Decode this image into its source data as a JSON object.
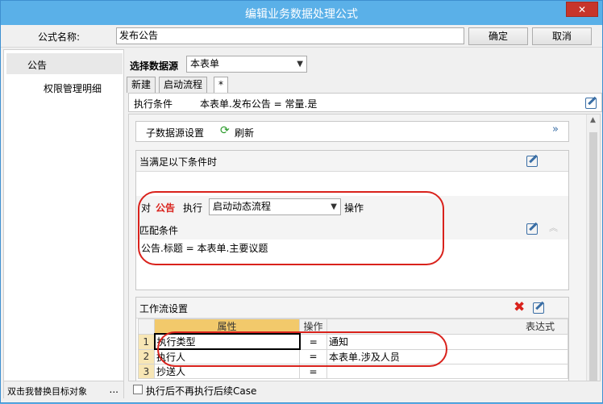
{
  "window": {
    "title": "编辑业务数据处理公式",
    "close_label": "✕"
  },
  "top": {
    "name_label": "公式名称:",
    "name_value": "发布公告",
    "ok_label": "确定",
    "cancel_label": "取消"
  },
  "sidebar": {
    "items": [
      {
        "label": "公告"
      },
      {
        "label": "权限管理明细"
      }
    ],
    "replace_target_label": "双击我替换目标对象",
    "more_label": "..."
  },
  "datasource": {
    "label": "选择数据源",
    "value": "本表单"
  },
  "tabs": [
    {
      "label": "新建"
    },
    {
      "label": "启动流程"
    },
    {
      "label": "*"
    }
  ],
  "exec_condition": {
    "label": "执行条件",
    "value": "本表单.发布公告 = 常量.是"
  },
  "subsource": {
    "label": "子数据源设置",
    "refresh_label": "刷新"
  },
  "when_panel": {
    "header": "当满足以下条件时"
  },
  "action_row": {
    "prefix": "对",
    "target": "公告",
    "exec_label": "执行",
    "action_value": "启动动态流程",
    "suffix": "操作"
  },
  "match": {
    "label": "匹配条件",
    "value": "公告.标题 = 本表单.主要议题"
  },
  "workflow": {
    "header": "工作流设置",
    "columns": [
      "",
      "属性",
      "操作",
      "表达式"
    ],
    "rows": [
      {
        "num": "1",
        "attr": "执行类型",
        "op": "=",
        "expr": "通知"
      },
      {
        "num": "2",
        "attr": "执行人",
        "op": "=",
        "expr": "本表单.涉及人员"
      },
      {
        "num": "3",
        "attr": "抄送人",
        "op": "=",
        "expr": ""
      }
    ]
  },
  "footer": {
    "checkbox_label": "执行后不再执行后续Case"
  },
  "colors": {
    "titlebar": "#5ab0e8",
    "accent_red": "#d9221c",
    "grid_header": "#f2c96b"
  }
}
